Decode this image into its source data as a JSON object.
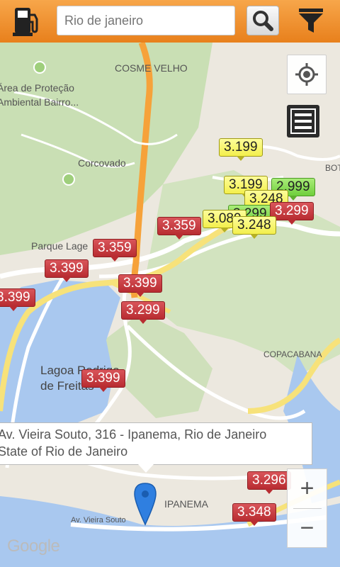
{
  "search": {
    "placeholder": "Rio de janeiro",
    "value": "Rio de janeiro"
  },
  "icons": {
    "app": "fuel-pump-icon",
    "search": "magnifier-icon",
    "filter": "funnel-icon",
    "locate": "my-location-icon",
    "list": "list-view-icon",
    "marker": "location-marker-icon"
  },
  "colors": {
    "topbar": "#ef8f28",
    "price_high": "#c8383d",
    "price_mid": "#f7f46a",
    "price_low": "#8ee15a",
    "route": "#f6a23a"
  },
  "map_labels": {
    "cosme_velho": "COSME VELHO",
    "protecao": "Área de Proteção\nAmbiental Bairro...",
    "corcovado": "Corcovado",
    "parque_lage": "Parque Lage",
    "lagoa": "Lagoa Rodrigo\nde Freitas",
    "copacabana": "COPACABANA",
    "ipanema": "IPANEMA",
    "av_vieira": "Av. Vieira Souto",
    "bot": "BOT"
  },
  "prices": [
    {
      "id": "p1",
      "value": "3.199",
      "level": "mid"
    },
    {
      "id": "p2",
      "value": "3.199",
      "level": "mid"
    },
    {
      "id": "p3",
      "value": "2.999",
      "level": "low"
    },
    {
      "id": "p4",
      "value": "3.248",
      "level": "mid"
    },
    {
      "id": "p5",
      "value": "3.299",
      "level": "low"
    },
    {
      "id": "p6",
      "value": "3.299",
      "level": "high"
    },
    {
      "id": "p7",
      "value": "3.089",
      "level": "mid"
    },
    {
      "id": "p8",
      "value": "3.248",
      "level": "mid"
    },
    {
      "id": "p9",
      "value": "3.359",
      "level": "high"
    },
    {
      "id": "p10",
      "value": "3.359",
      "level": "high"
    },
    {
      "id": "p11",
      "value": "3.399",
      "level": "high"
    },
    {
      "id": "p12",
      "value": "3.399",
      "level": "high"
    },
    {
      "id": "p13",
      "value": "3.399",
      "level": "high"
    },
    {
      "id": "p14",
      "value": "3.299",
      "level": "high"
    },
    {
      "id": "p15",
      "value": "3.399",
      "level": "high"
    },
    {
      "id": "p16",
      "value": "3.296",
      "level": "high"
    },
    {
      "id": "p17",
      "value": "3.348",
      "level": "high"
    }
  ],
  "info_window": {
    "line1": "Av. Vieira Souto, 316 - Ipanema, Rio de Janeiro",
    "line2": "State of Rio de Janeiro"
  },
  "zoom": {
    "in": "+",
    "out": "−"
  },
  "attribution": "Google"
}
